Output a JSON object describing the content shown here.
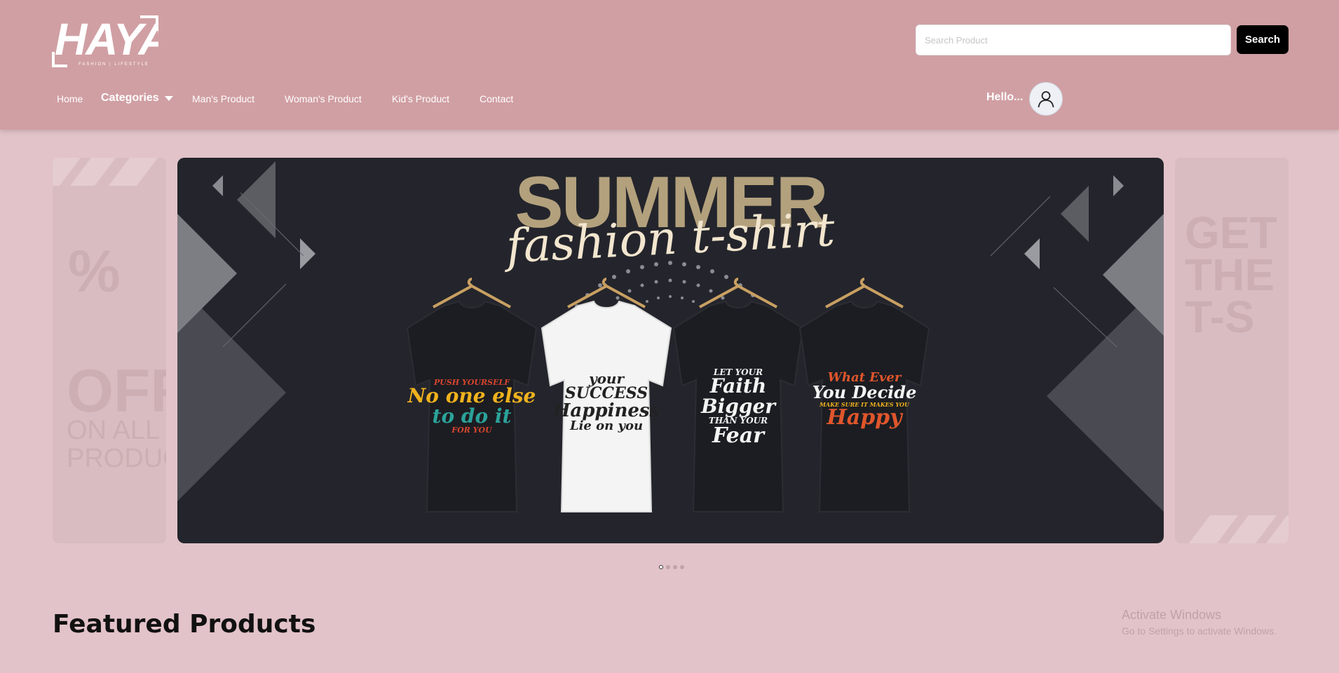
{
  "header": {
    "logo": {
      "wordmark": "HAYA",
      "tagline": "FASHION | LIFESTYLE"
    },
    "search": {
      "placeholder": "Search Product",
      "value": "",
      "button_label": "Search"
    },
    "nav": [
      {
        "label": "Home"
      },
      {
        "label": "Categories",
        "has_dropdown": true
      },
      {
        "label": "Man's Product"
      },
      {
        "label": "Woman's Product"
      },
      {
        "label": "Kid's Product"
      },
      {
        "label": "Contact"
      }
    ],
    "greeting": "Hello..."
  },
  "carousel": {
    "left_card": {
      "line1": "%",
      "line2": "OFF",
      "line3": "ON ALL",
      "line4": "PRODUCTS"
    },
    "right_card": {
      "line1": "GET",
      "line2": "THE",
      "line3": "T-S"
    },
    "banner": {
      "title": "SUMMER",
      "subtitle": "fashion t-shirt",
      "shirts": [
        {
          "color": "#1c1d22",
          "text_lines": [
            "PUSH YOURSELF",
            "No one else",
            "to do it",
            "FOR YOU"
          ],
          "text_colors": [
            "#d9452e",
            "#f0b21d",
            "#2ba39a",
            "#d9452e"
          ]
        },
        {
          "color": "#f4f4f4",
          "text_lines": [
            "your",
            "SUCCESS",
            "Happiness",
            "Lie on you"
          ],
          "text_colors": [
            "#222",
            "#222",
            "#222",
            "#222"
          ]
        },
        {
          "color": "#1c1d22",
          "text_lines": [
            "LET YOUR",
            "Faith",
            "Bigger",
            "THAN YOUR",
            "Fear"
          ],
          "text_colors": [
            "#f4f4f4",
            "#f4f4f4",
            "#f4f4f4",
            "#f4f4f4",
            "#f4f4f4"
          ]
        },
        {
          "color": "#1c1d22",
          "text_lines": [
            "What Ever",
            "You Decide",
            "MAKE SURE IT MAKES YOU",
            "Happy"
          ],
          "text_colors": [
            "#e0562c",
            "#f4f4f4",
            "#f0b21d",
            "#e0562c"
          ]
        }
      ]
    },
    "slide_count": 4,
    "active_slide": 0
  },
  "featured": {
    "title": "Featured Products"
  },
  "watermark": {
    "title": "Activate Windows",
    "subtitle": "Go to Settings to activate Windows."
  },
  "colors": {
    "header_bg": "#d09fa3",
    "page_bg": "#e2c3c9",
    "banner_bg": "#24252c",
    "button_bg": "#000000"
  }
}
